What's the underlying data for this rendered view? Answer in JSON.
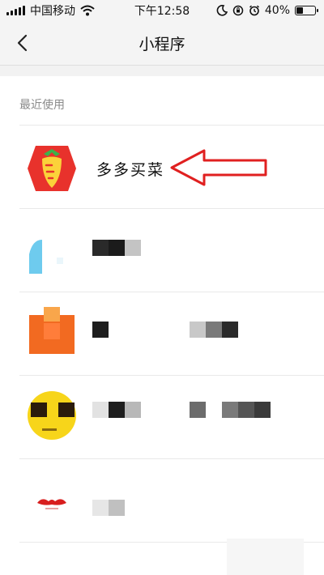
{
  "status_bar": {
    "carrier": "中国移动",
    "time": "下午12:58",
    "battery": "40%",
    "battery_level": 0.4
  },
  "nav": {
    "title": "小程序",
    "back_icon": "chevron-left-icon"
  },
  "section": {
    "header": "最近使用"
  },
  "items": [
    {
      "label": "多多买菜",
      "icon": "carrot-app-icon"
    },
    {
      "label": "",
      "icon": "blurred-app-icon"
    },
    {
      "label": "",
      "icon": "orange-app-icon"
    },
    {
      "label": "",
      "icon": "yellow-face-app-icon"
    },
    {
      "label": "",
      "icon": "red-logo-app-icon"
    }
  ],
  "annotation": {
    "arrow_color": "#e02020",
    "target": "多多买菜"
  }
}
